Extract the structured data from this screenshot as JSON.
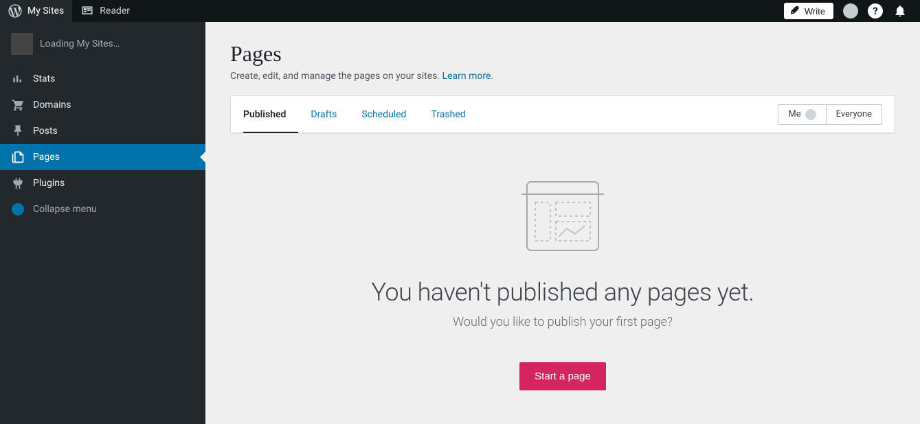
{
  "topbar": {
    "mySites": "My Sites",
    "reader": "Reader",
    "write": "Write"
  },
  "sidebar": {
    "loading": "Loading My Sites…",
    "items": {
      "stats": "Stats",
      "domains": "Domains",
      "posts": "Posts",
      "pages": "Pages",
      "plugins": "Plugins"
    },
    "collapse": "Collapse menu"
  },
  "main": {
    "title": "Pages",
    "subtitle_prefix": "Create, edit, and manage the pages on your sites. ",
    "learn_more": "Learn more.",
    "tabs": {
      "published": "Published",
      "drafts": "Drafts",
      "scheduled": "Scheduled",
      "trashed": "Trashed"
    },
    "filters": {
      "me": "Me",
      "everyone": "Everyone"
    },
    "empty": {
      "title": "You haven't published any pages yet.",
      "subtitle": "Would you like to publish your first page?",
      "cta": "Start a page"
    }
  }
}
